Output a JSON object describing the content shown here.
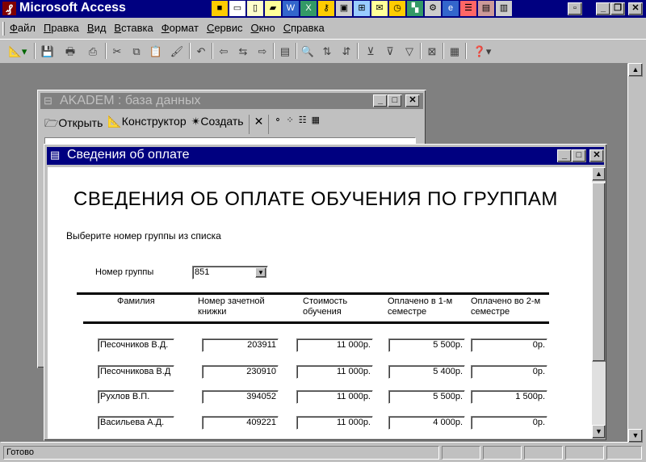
{
  "app": {
    "title": "Microsoft Access"
  },
  "menu": [
    "Файл",
    "Правка",
    "Вид",
    "Вставка",
    "Формат",
    "Сервис",
    "Окно",
    "Справка"
  ],
  "db_window": {
    "title": "AKADEM : база данных",
    "open_label": "Открыть",
    "design_label": "Конструктор",
    "create_label": "Создать"
  },
  "form_window": {
    "title": "Сведения об оплате"
  },
  "form": {
    "heading": "СВЕДЕНИЯ ОБ ОПЛАТЕ ОБУЧЕНИЯ ПО ГРУППАМ",
    "instruction": "Выберите номер группы из списка",
    "group_label": "Номер группы",
    "group_value": "851",
    "columns": {
      "surname": "Фамилия",
      "record_book_1": "Номер зачетной",
      "record_book_2": "книжки",
      "cost_1": "Стоимость",
      "cost_2": "обучения",
      "paid1_1": "Оплачено в 1-м",
      "paid1_2": "семестре",
      "paid2_1": "Оплачено во 2-м",
      "paid2_2": "семестре"
    },
    "rows": [
      {
        "surname": "Песочников В.Д.",
        "book": "203911",
        "cost": "11 000р.",
        "paid1": "5 500р.",
        "paid2": "0р."
      },
      {
        "surname": "Песочникова В.Д",
        "book": "230910",
        "cost": "11 000р.",
        "paid1": "5 400р.",
        "paid2": "0р."
      },
      {
        "surname": "Рухлов В.П.",
        "book": "394052",
        "cost": "11 000р.",
        "paid1": "5 500р.",
        "paid2": "1 500р."
      },
      {
        "surname": "Васильева А.Д.",
        "book": "409221",
        "cost": "11 000р.",
        "paid1": "4 000р.",
        "paid2": "0р."
      }
    ]
  },
  "status": {
    "text": "Готово"
  },
  "colors": {
    "title_active": "#000080",
    "title_inactive": "#808080",
    "face": "#c0c0c0",
    "workspace": "#808080"
  }
}
